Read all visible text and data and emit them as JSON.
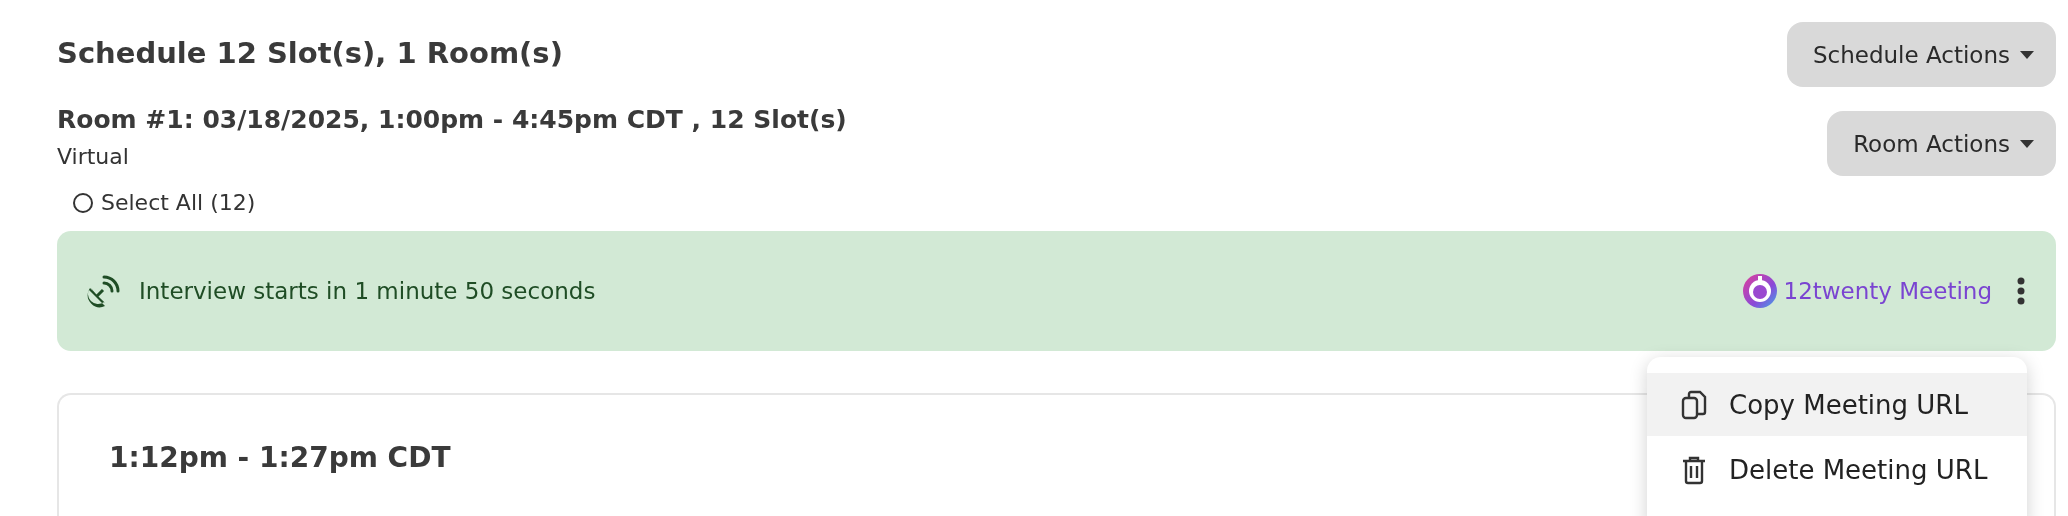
{
  "schedule": {
    "title": "Schedule 12 Slot(s), 1 Room(s)",
    "actions_button": "Schedule Actions"
  },
  "room": {
    "title": "Room #1: 03/18/2025, 1:00pm - 4:45pm CDT , 12 Slot(s)",
    "location": "Virtual",
    "actions_button": "Room Actions"
  },
  "select_all": {
    "label": "Select All (12)",
    "checked": false
  },
  "banner": {
    "message": "Interview starts in 1 minute 50 seconds",
    "meeting_link": "12twenty Meeting"
  },
  "menu": {
    "items": [
      {
        "kind": "copy",
        "label": "Copy Meeting URL",
        "highlighted": true
      },
      {
        "kind": "delete",
        "label": "Delete Meeting URL",
        "highlighted": false
      }
    ]
  },
  "slot": {
    "time": "1:12pm - 1:27pm CDT"
  }
}
